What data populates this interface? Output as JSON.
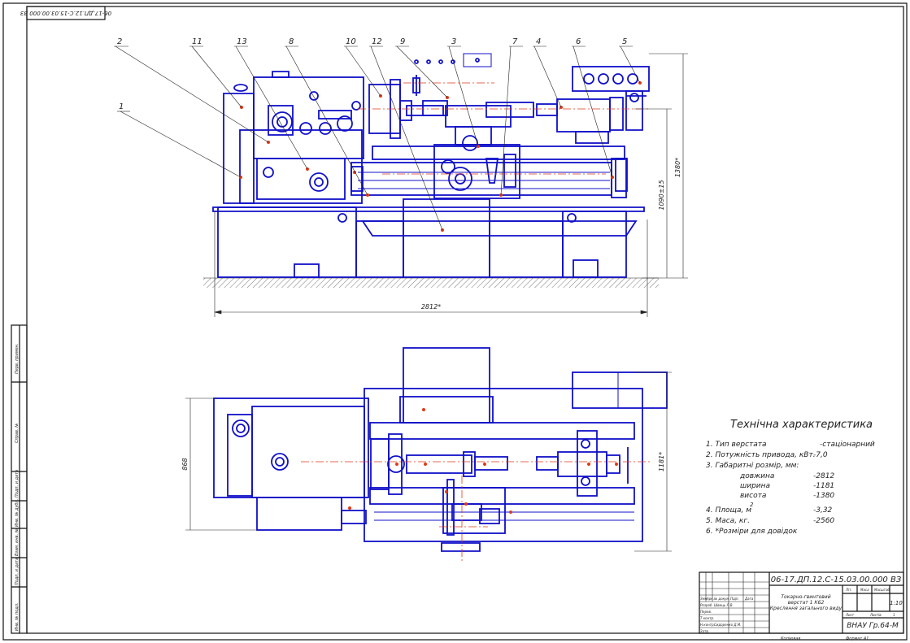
{
  "drawing": {
    "rotated_code": "06-17.ДП.12.С-15.03.00.000 ВЗ",
    "callouts": [
      "2",
      "11",
      "13",
      "8",
      "10",
      "12",
      "9",
      "3",
      "7",
      "4",
      "6",
      "5",
      "1"
    ],
    "dimensions": {
      "length": "2812*",
      "height": "1380*",
      "center_height": "1090±15",
      "plan_width": "1181*",
      "plan_depth": "868"
    }
  },
  "tech": {
    "title": "Технічна характеристика",
    "rows": [
      {
        "label": "1. Тип верстата",
        "value": "-стаціонарний"
      },
      {
        "label": "2. Потужність привода, кВт.",
        "value": "-7,0"
      },
      {
        "label": "3. Габаритні розмір, мм:",
        "value": ""
      },
      {
        "label": "довжина",
        "value": "-2812"
      },
      {
        "label": "ширина",
        "value": "-1181"
      },
      {
        "label": "висота",
        "value": "-1380"
      },
      {
        "label": "4. Площа, м",
        "value": "-3,32"
      },
      {
        "label": "5. Маса, кг.",
        "value": "-2560"
      },
      {
        "label": "6. *Розміри для довідок",
        "value": ""
      }
    ],
    "superscript": "2"
  },
  "titleblock": {
    "code": "06-17.ДП.12.С-15.03.00.000 ВЗ",
    "name_line1": "Токарно-гвинтовий",
    "name_line2": "верстат 1 К62",
    "name_line3": "Креслення загального виду",
    "scale": "1:10",
    "org": "ВНАУ Гр.64-М",
    "col_lit": "Літ.",
    "col_mass": "Маса",
    "col_scale": "Масштаб",
    "sheet": "Лист",
    "sheets": "Листів",
    "sheets_count": "1",
    "heads": [
      "Змн.",
      "Арк.",
      "№ докум.",
      "Підп.",
      "Дата"
    ],
    "roles": [
      "Розроб.",
      "Перев.",
      "Т.контр.",
      "Н.контр.",
      "Затв."
    ],
    "people": [
      "Швець Л.В.",
      "Сидоренко Д.М."
    ],
    "bottom_left": "Копіював",
    "bottom_right": "Формат А1"
  },
  "sidebar": {
    "cells": [
      "Перв. примен.",
      "Справ. №",
      "Подп. и дата",
      "Инв. № дубл.",
      "Взам. инв. №",
      "Подп. и дата",
      "Инв. № подл."
    ]
  }
}
